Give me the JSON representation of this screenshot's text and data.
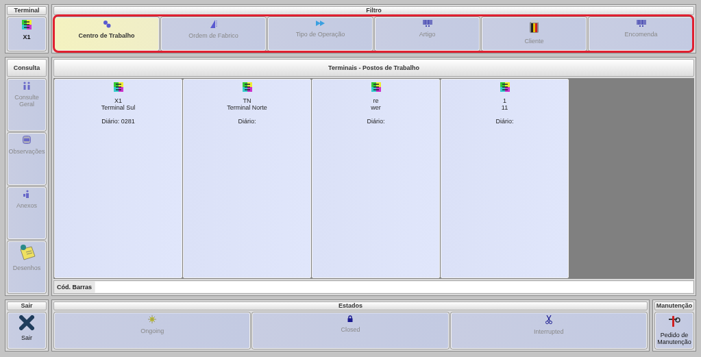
{
  "terminal": {
    "header": "Terminal",
    "button": "X1"
  },
  "filter": {
    "header": "Filtro",
    "buttons": [
      {
        "label": "Centro de Trabalho",
        "selected": true
      },
      {
        "label": "Ordem de Fabrico",
        "selected": false
      },
      {
        "label": "Tipo de Operação",
        "selected": false
      },
      {
        "label": "Artigo",
        "selected": false
      },
      {
        "label": "Cliente",
        "selected": false
      },
      {
        "label": "Encomenda",
        "selected": false
      }
    ]
  },
  "consulta": {
    "header": "Consulta",
    "items": [
      "Consulte Geral",
      "Observações",
      "Anexos",
      "Desenhos"
    ]
  },
  "terminals": {
    "header": "Terminais - Postos de Trabalho",
    "cards": [
      {
        "code": "X1",
        "name": "Terminal Sul",
        "diario": "Diário: 0281"
      },
      {
        "code": "TN",
        "name": "Terminal Norte",
        "diario": "Diário:"
      },
      {
        "code": "re",
        "name": "wer",
        "diario": "Diário:"
      },
      {
        "code": "1",
        "name": "11",
        "diario": "Diário:"
      }
    ]
  },
  "barcode": {
    "label": "Cód. Barras"
  },
  "sair": {
    "header": "Sair",
    "button": "Sair"
  },
  "estados": {
    "header": "Estados",
    "buttons": [
      "Ongoing",
      "Closed",
      "Interrupted"
    ]
  },
  "manutencao": {
    "header": "Manutenção",
    "button": "Pedido de Manutenção"
  }
}
